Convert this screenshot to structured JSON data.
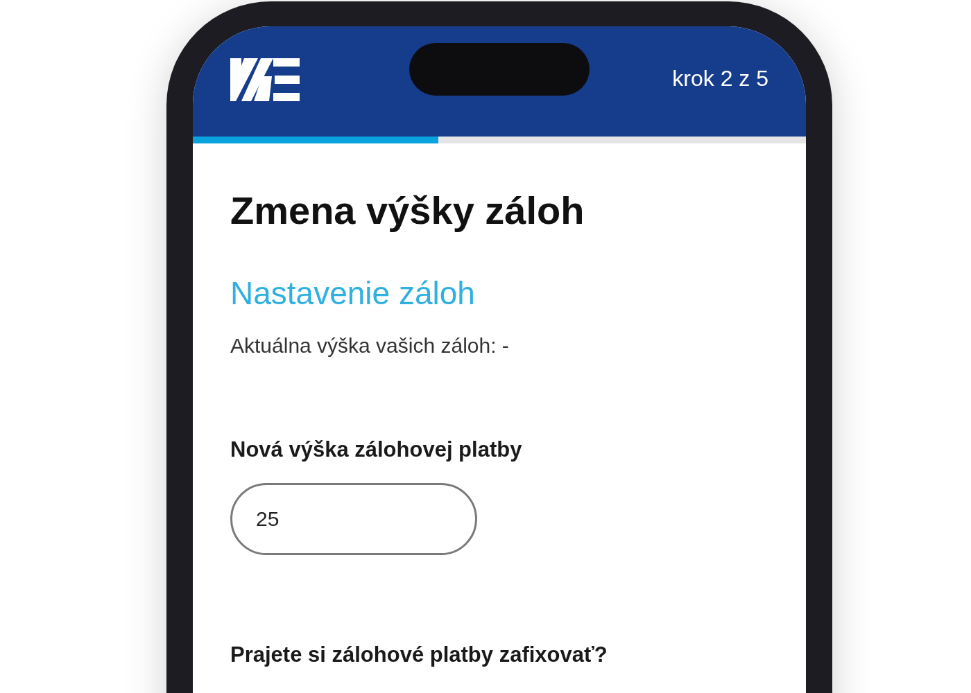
{
  "header": {
    "step": "krok 2 z 5"
  },
  "progress": {
    "level": 0.4
  },
  "title": "Zmena výšky záloh",
  "section_title": "Nastavenie záloh",
  "current_amount": "Aktuálna výška vašich záloh: -",
  "amount_field": {
    "label": "Nová výška zálohovej platby",
    "value": "25"
  },
  "question": "Prajete si zálohové platby zafixovať?"
}
